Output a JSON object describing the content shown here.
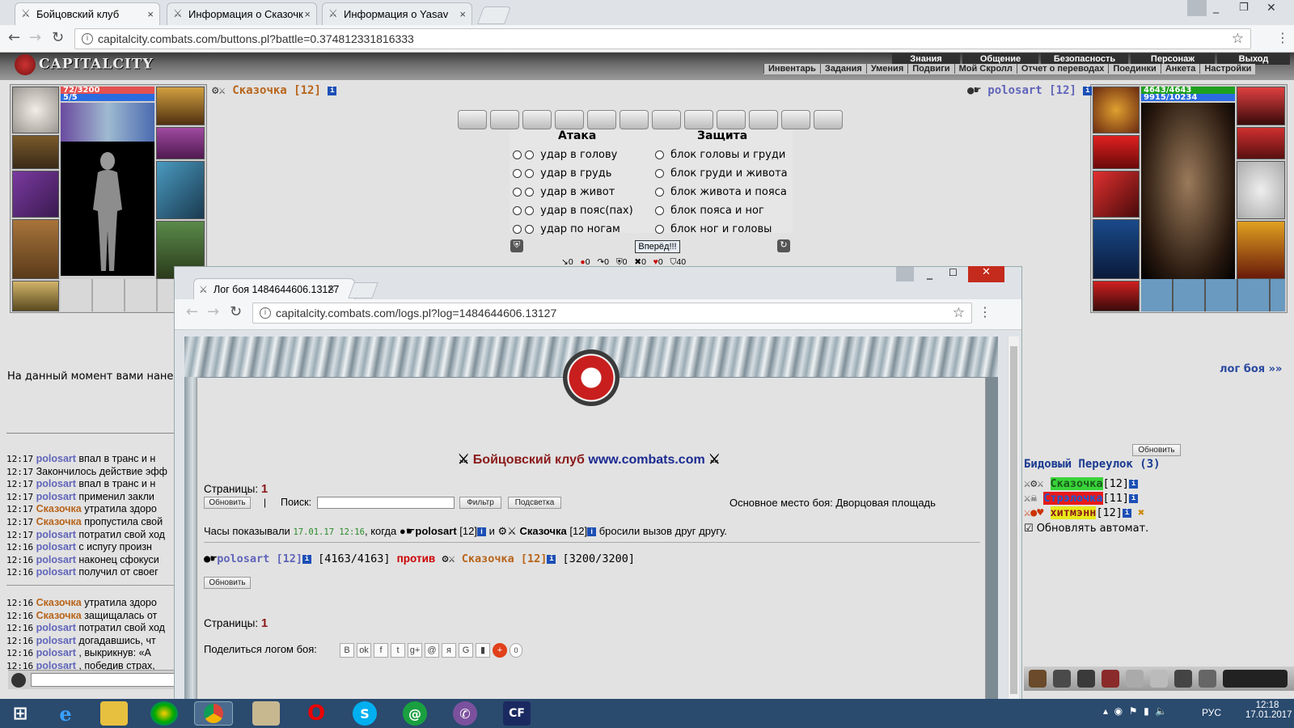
{
  "browser": {
    "tabs": [
      {
        "label": "Бойцовский клуб",
        "close": "×"
      },
      {
        "label": "Информация о Сказочк",
        "close": "×"
      },
      {
        "label": "Информация о Yasav",
        "close": "×"
      }
    ],
    "url": "capitalcity.combats.com/buttons.pl?battle=0.374812331816333",
    "window_controls": [
      "_",
      "❐",
      "✕"
    ]
  },
  "game": {
    "logo": "CAPITALCITY",
    "menu_top": [
      "Знания",
      "Общение",
      "Безопасность",
      "Персонаж",
      "Выход"
    ],
    "menu_bottom": [
      "Инвентарь",
      "Задания",
      "Умения",
      "Подвиги",
      "Мой Скролл",
      "Отчет о переводах",
      "Поединки",
      "Анкета",
      "Настройки"
    ],
    "left_player": {
      "name": "Сказочка",
      "level": "[12]",
      "hp": "72/3200",
      "mana": "5/5"
    },
    "right_player": {
      "name": "polosart",
      "level": "[12]",
      "hp": "4643/4643",
      "mana": "9915/10234"
    },
    "attack_header": "Атака",
    "defense_header": "Защита",
    "attacks": [
      "удар в голову",
      "удар в грудь",
      "удар в живот",
      "удар в пояс(пах)",
      "удар по ногам"
    ],
    "blocks": [
      "блок головы и груди",
      "блок груди и живота",
      "блок живота и пояса",
      "блок пояса и ног",
      "блок ног и головы"
    ],
    "forward_btn": "Вперёд!!!",
    "stats": [
      "0",
      "0",
      "0",
      "0",
      "0",
      "0",
      "40"
    ],
    "notice": "На данный момент вами нане",
    "log_link": "лог боя »»",
    "chat": [
      {
        "t": "12:17",
        "who": "polosart",
        "c": "p",
        "msg": "впал в транс и н"
      },
      {
        "t": "12:17",
        "who": "",
        "c": "",
        "msg": "Закончилось действие эфф"
      },
      {
        "t": "12:17",
        "who": "polosart",
        "c": "p",
        "msg": "впал в транс и н"
      },
      {
        "t": "12:17",
        "who": "polosart",
        "c": "p",
        "msg": "применил закли"
      },
      {
        "t": "12:17",
        "who": "Сказочка",
        "c": "s",
        "msg": "утратила здоро"
      },
      {
        "t": "12:17",
        "who": "Сказочка",
        "c": "s",
        "msg": "пропустила свой"
      },
      {
        "t": "12:17",
        "who": "polosart",
        "c": "p",
        "msg": "потратил свой ход"
      },
      {
        "t": "12:16",
        "who": "polosart",
        "c": "p",
        "msg": "с испугу произн"
      },
      {
        "t": "12:16",
        "who": "polosart",
        "c": "p",
        "msg": "наконец сфокуси"
      },
      {
        "t": "12:16",
        "who": "polosart",
        "c": "p",
        "msg": "получил от своег"
      },
      {
        "t": "",
        "who": "",
        "c": "",
        "msg": ""
      },
      {
        "t": "12:16",
        "who": "Сказочка",
        "c": "s",
        "msg": "утратила здоро"
      },
      {
        "t": "12:16",
        "who": "Сказочка",
        "c": "s",
        "msg": "защищалась от"
      },
      {
        "t": "12:16",
        "who": "polosart",
        "c": "p",
        "msg": "потратил свой ход"
      },
      {
        "t": "12:16",
        "who": "polosart",
        "c": "p",
        "msg": "догадавшись, чт"
      },
      {
        "t": "12:16",
        "who": "polosart",
        "c": "p",
        "msg": ", выкрикнув: «А"
      },
      {
        "t": "12:16",
        "who": "polosart",
        "c": "p",
        "msg": ", победив страх,"
      },
      {
        "t": "",
        "who": "",
        "c": "",
        "msg": "Часы показывали 17.01.17 12:1"
      }
    ],
    "refresh_btn": "Обновить",
    "room": {
      "title": "Бидовый Переулок (3)",
      "members": [
        {
          "name": "Сказочка",
          "level": "[12]",
          "bg": "#3ad43a"
        },
        {
          "name": "Стрэлочка",
          "level": "[11]",
          "bg": "#e81a1a"
        },
        {
          "name": "хитмэнн",
          "level": "[12]",
          "bg": "#e8e81a"
        }
      ],
      "auto_refresh": "Обновлять автомат."
    }
  },
  "popup": {
    "tab_label": "Лог боя 1484644606.13127",
    "url": "capitalcity.combats.com/logs.pl?log=1484644606.13127",
    "club_title": "Бойцовский клуб",
    "club_site": "www.combats.com",
    "pages_label": "Страницы:",
    "pages_num": "1",
    "refresh": "Обновить",
    "search_label": "Поиск:",
    "filter": "Фильтр",
    "highlight": "Подсветка",
    "place": "Основное место боя: Дворцовая площадь",
    "clock_pre": "Часы показывали",
    "clock_time": "17.01.17 12:16",
    "clock_when": ", когда",
    "p1": "polosart",
    "p1lvl": "[12]",
    "and": "и",
    "p2": "Сказочка",
    "p2lvl": "[12]",
    "challenge": "бросили вызов друг другу.",
    "p1hp": "[4163/4163]",
    "vs": "против",
    "p2hp": "[3200/3200]",
    "share_label": "Поделиться логом боя:",
    "share_btns": [
      "B",
      "ok",
      "f",
      "t",
      "g+",
      "@",
      "я",
      "G",
      "▮",
      "+",
      "0"
    ]
  },
  "taskbar": {
    "lang": "РУС",
    "time": "12:18",
    "date": "17.01.2017"
  },
  "colors": {
    "polosart": "#6065b9",
    "skazochka": "#b8651b",
    "red": "#cc0000"
  }
}
